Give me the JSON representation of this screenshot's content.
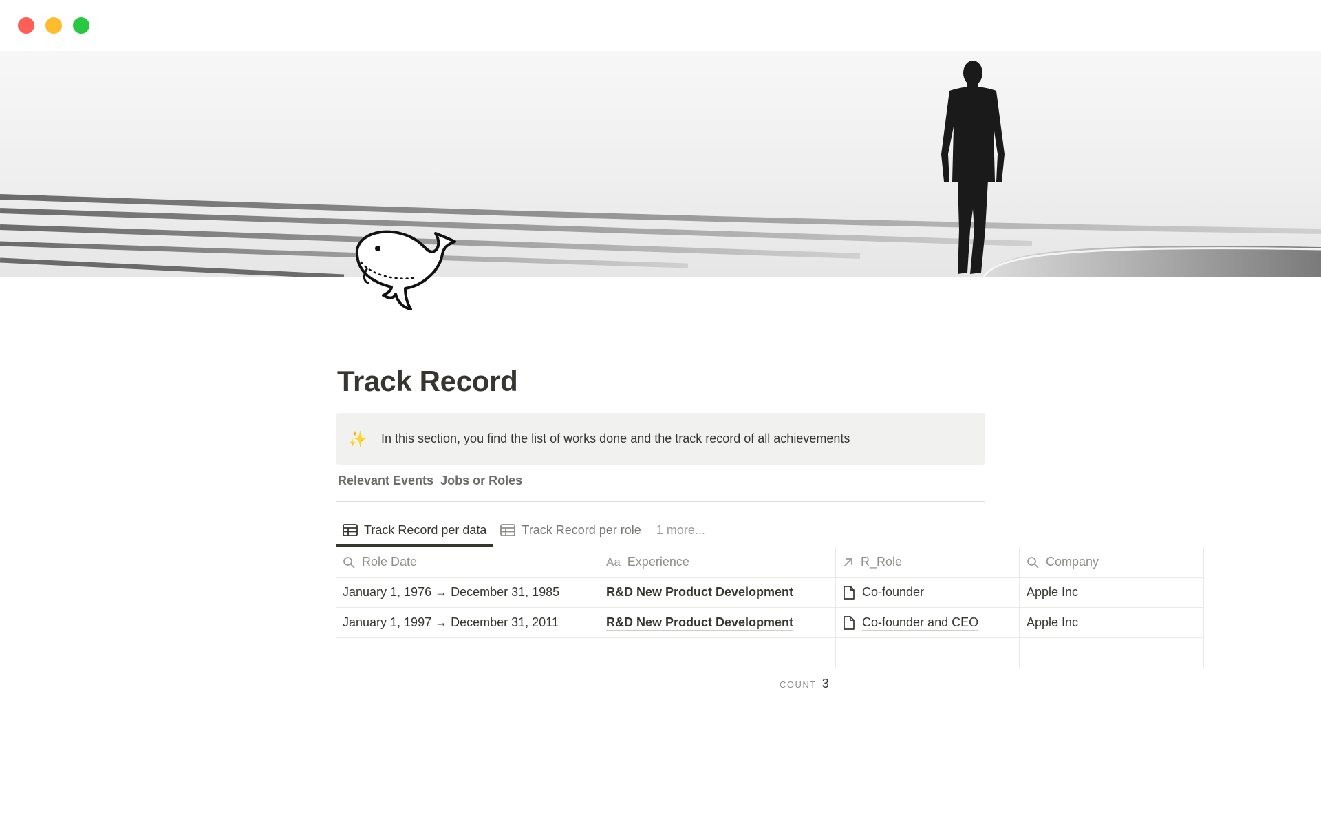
{
  "page": {
    "title": "Track Record",
    "callout": {
      "icon": "sparkles-icon",
      "text": "In this section, you find the list of works done and the track record of all achievements"
    },
    "links": [
      "Relevant Events",
      "Jobs or Roles"
    ]
  },
  "tabs": [
    {
      "label": "Track Record per data",
      "icon": "table-icon",
      "active": true
    },
    {
      "label": "Track Record per role",
      "icon": "table-icon",
      "active": false
    }
  ],
  "tabs_more": "1 more...",
  "table": {
    "columns": [
      {
        "label": "Role Date",
        "icon": "search-icon"
      },
      {
        "label": "Experience",
        "icon": "title-aa-icon"
      },
      {
        "label": "R_Role",
        "icon": "relation-arrow-icon"
      },
      {
        "label": "Company",
        "icon": "search-icon"
      }
    ],
    "rows": [
      {
        "date": "January 1, 1976 → December 31, 1985",
        "experience": "R&D New Product Development",
        "role": "Co-founder",
        "company": "Apple Inc"
      },
      {
        "date": "January 1, 1997 → December 31, 2011",
        "experience": "R&D New Product Development",
        "role": "Co-founder and CEO",
        "company": "Apple Inc"
      }
    ]
  },
  "footer": {
    "count_label": "COUNT",
    "count_value": "3"
  },
  "colors": {
    "traffic_red": "#fe5f57",
    "traffic_yellow": "#febc2e",
    "traffic_green": "#28c840",
    "callout_bg": "#f1f1ef"
  }
}
